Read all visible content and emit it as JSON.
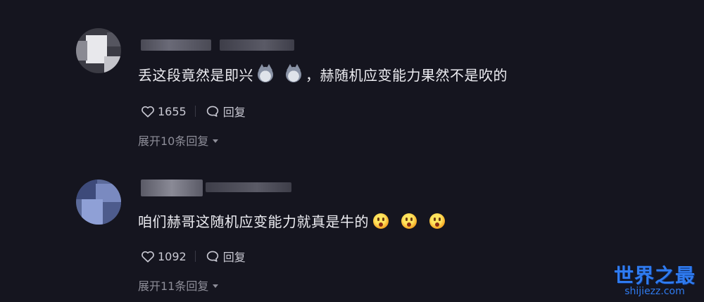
{
  "comments": [
    {
      "text_before": "丢这段竟然是即兴",
      "text_after": "，赫随机应变能力果然不是吹的",
      "emojis": [
        "husky-emoji",
        "husky-emoji"
      ],
      "likes": "1655",
      "reply_label": "回复",
      "expand_label": "展开10条回复"
    },
    {
      "text_before": "咱们赫哥这随机应变能力就真是牛的",
      "text_after": "",
      "emojis": [
        "surprised-emoji",
        "surprised-emoji",
        "surprised-emoji"
      ],
      "likes": "1092",
      "reply_label": "回复",
      "expand_label": "展开11条回复"
    }
  ],
  "watermark": {
    "main": "世界之最",
    "sub": "shijiezz.com"
  },
  "colors": {
    "background": "#15151f",
    "text": "#ececf1",
    "muted": "#8e8e99",
    "watermark": "#2f7bf0"
  }
}
